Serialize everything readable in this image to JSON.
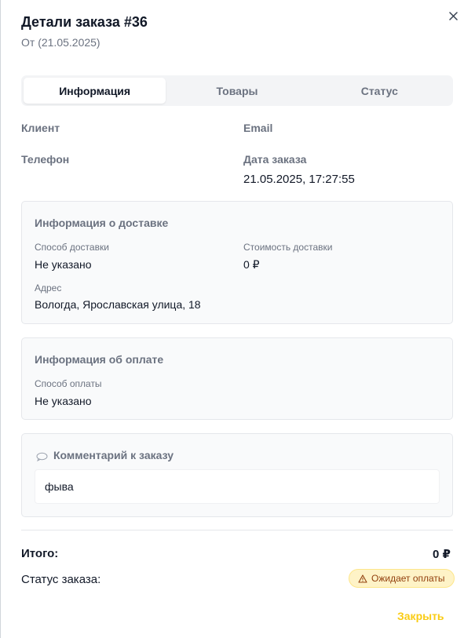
{
  "header": {
    "title": "Детали заказа #36",
    "subtitle": "От (21.05.2025)"
  },
  "tabs": [
    {
      "label": "Информация",
      "active": true
    },
    {
      "label": "Товары",
      "active": false
    },
    {
      "label": "Статус",
      "active": false
    }
  ],
  "info": {
    "client_label": "Клиент",
    "email_label": "Email",
    "phone_label": "Телефон",
    "order_date_label": "Дата заказа",
    "order_date_value": "21.05.2025, 17:27:55"
  },
  "delivery": {
    "title": "Информация о доставке",
    "method_label": "Способ доставки",
    "method_value": "Не указано",
    "cost_label": "Стоимость доставки",
    "cost_value": "0 ₽",
    "address_label": "Адрес",
    "address_value": "Вологда, Ярославская улица, 18"
  },
  "payment": {
    "title": "Информация об оплате",
    "method_label": "Способ оплаты",
    "method_value": "Не указано"
  },
  "comment": {
    "icon": "speech-bubble-icon",
    "title": "Комментарий к заказу",
    "text": "фыва"
  },
  "summary": {
    "total_label": "Итого:",
    "total_value": "0 ₽",
    "status_label": "Статус заказа:",
    "status_badge": "Ожидает оплаты",
    "status_icon": "warning-icon",
    "badge_color": "#fef3c7"
  },
  "footer": {
    "close_label": "Закрыть",
    "close_color": "#facc15"
  },
  "icons": {
    "close": "close-icon"
  }
}
